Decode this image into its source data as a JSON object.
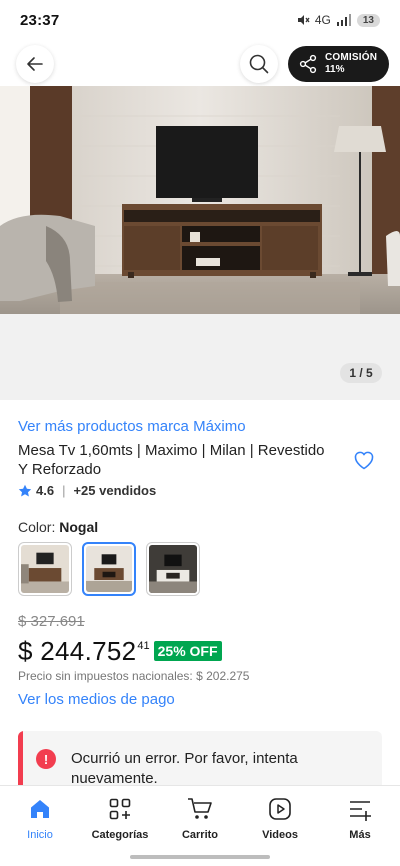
{
  "status_bar": {
    "time": "23:37",
    "signal_text": "4G",
    "battery": "13"
  },
  "top_bar": {
    "commission_label": "COMISIÓN",
    "commission_value": "11%"
  },
  "gallery": {
    "page_indicator": "1 / 5"
  },
  "product": {
    "brand_link": "Ver más productos marca Máximo",
    "title": "Mesa Tv 1,60mts | Maximo | Milan | Revestido Y Reforzado",
    "rating": "4.6",
    "sold": "+25 vendidos",
    "color_label": "Color:",
    "color_name": "Nogal",
    "swatches_count": 3,
    "selected_swatch_index": 1
  },
  "pricing": {
    "old_price": "$ 327.691",
    "price_main": "$ 244.752",
    "price_cents": "41",
    "discount": "25% OFF",
    "price_no_tax": "Precio sin impuestos nacionales: $ 202.275",
    "payment_link": "Ver los medios de pago"
  },
  "error": {
    "icon": "!",
    "message": "Ocurrió un error. Por favor, intenta nuevamente."
  },
  "bottom_nav": {
    "items": [
      {
        "label": "Inicio",
        "icon": "home-icon",
        "active": true
      },
      {
        "label": "Categorías",
        "icon": "categories-icon",
        "active": false
      },
      {
        "label": "Carrito",
        "icon": "cart-icon",
        "active": false
      },
      {
        "label": "Videos",
        "icon": "video-icon",
        "active": false
      },
      {
        "label": "Más",
        "icon": "more-menu-icon",
        "active": false
      }
    ]
  },
  "colors": {
    "accent_blue": "#3483fa",
    "discount_green": "#00a650",
    "error_red": "#f23d4f"
  }
}
